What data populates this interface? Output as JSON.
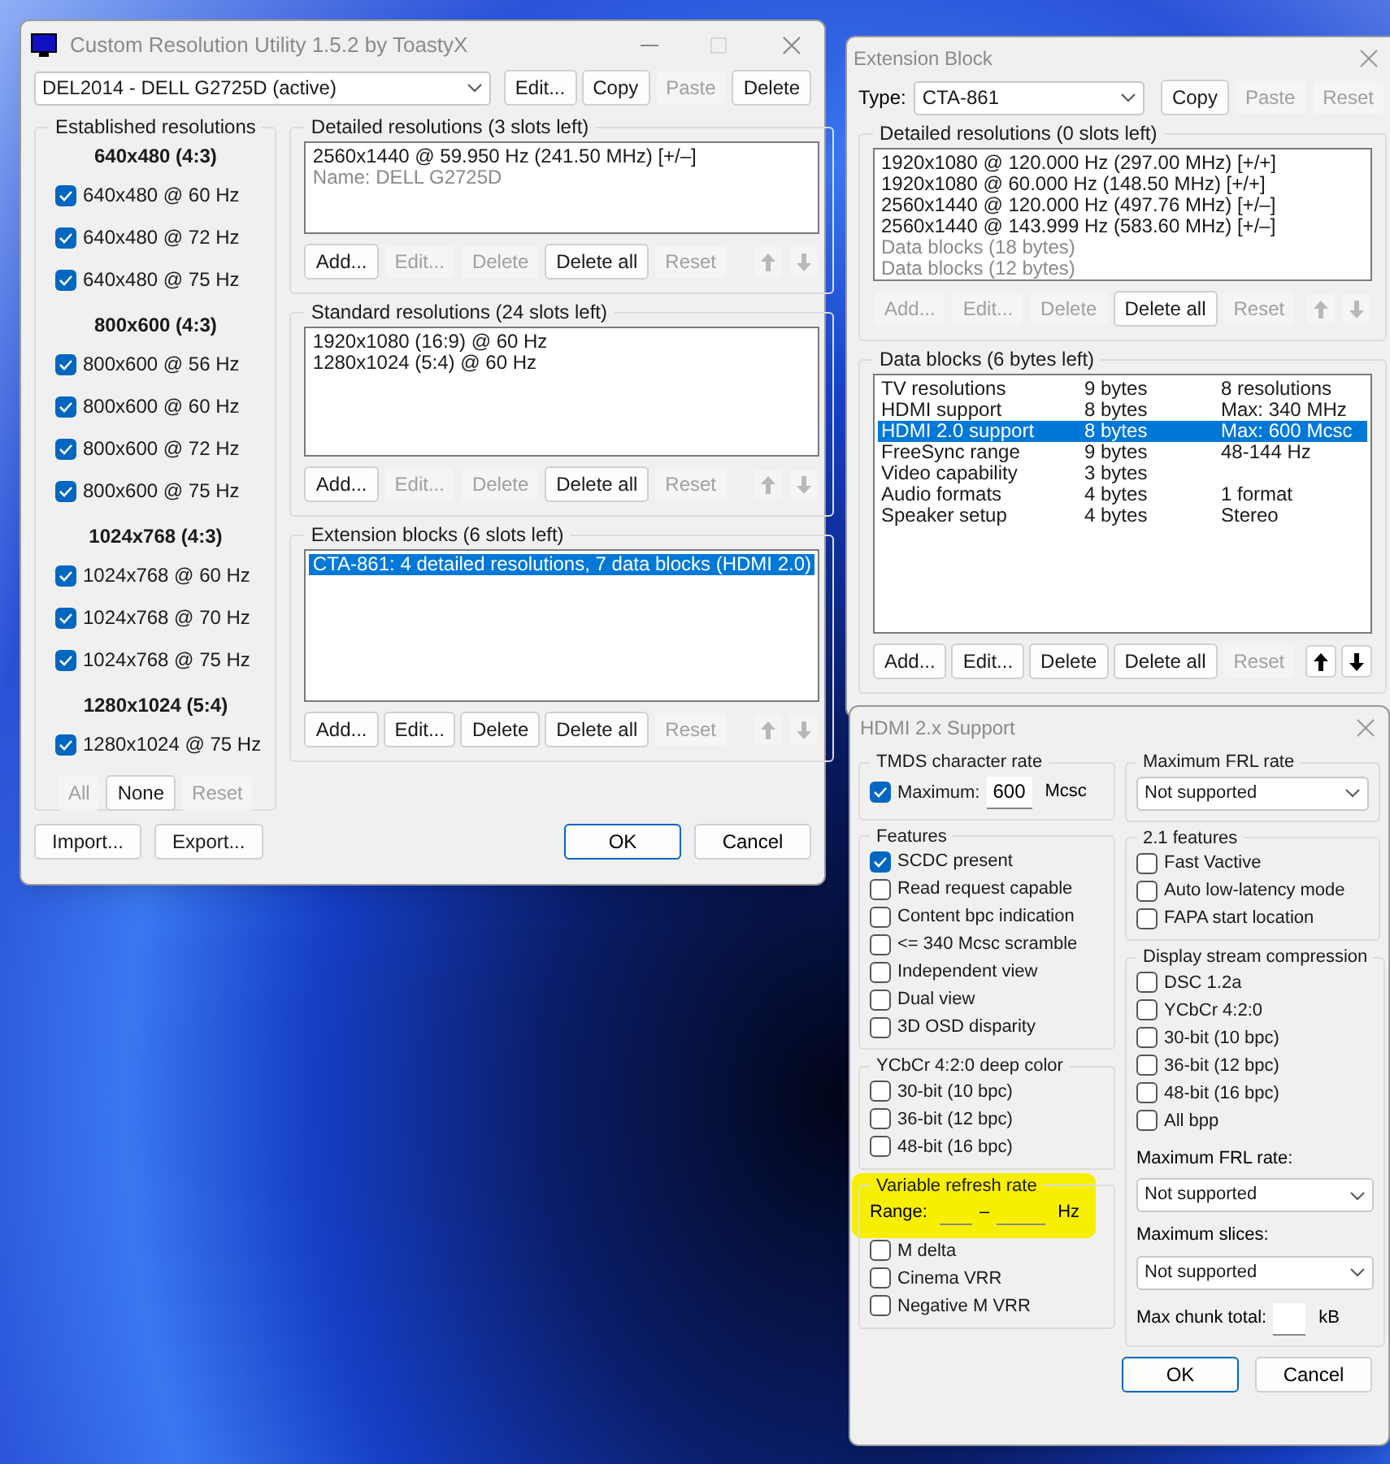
{
  "main_window": {
    "title": "Custom Resolution Utility 1.5.2 by ToastyX",
    "maximize_disabled": true,
    "monitor": "DEL2014 - DELL G2725D (active)",
    "top_buttons": [
      {
        "label": "Edit...",
        "disabled": false
      },
      {
        "label": "Copy",
        "disabled": false
      },
      {
        "label": "Paste",
        "disabled": true
      },
      {
        "label": "Delete",
        "disabled": false
      }
    ],
    "established": {
      "title": "Established resolutions",
      "groups": [
        {
          "heading": "640x480 (4:3)",
          "items": [
            {
              "label": "640x480 @ 60 Hz",
              "checked": true
            },
            {
              "label": "640x480 @ 72 Hz",
              "checked": true
            },
            {
              "label": "640x480 @ 75 Hz",
              "checked": true
            }
          ]
        },
        {
          "heading": "800x600 (4:3)",
          "items": [
            {
              "label": "800x600 @ 56 Hz",
              "checked": true
            },
            {
              "label": "800x600 @ 60 Hz",
              "checked": true
            },
            {
              "label": "800x600 @ 72 Hz",
              "checked": true
            },
            {
              "label": "800x600 @ 75 Hz",
              "checked": true
            }
          ]
        },
        {
          "heading": "1024x768 (4:3)",
          "items": [
            {
              "label": "1024x768 @ 60 Hz",
              "checked": true
            },
            {
              "label": "1024x768 @ 70 Hz",
              "checked": true
            },
            {
              "label": "1024x768 @ 75 Hz",
              "checked": true
            }
          ]
        },
        {
          "heading": "1280x1024 (5:4)",
          "items": [
            {
              "label": "1280x1024 @ 75 Hz",
              "checked": true
            }
          ]
        }
      ],
      "buttons": [
        {
          "label": "All",
          "disabled": true
        },
        {
          "label": "None",
          "disabled": false
        },
        {
          "label": "Reset",
          "disabled": true
        }
      ]
    },
    "detailed": {
      "title": "Detailed resolutions (3 slots left)",
      "lines": [
        {
          "text": "2560x1440 @ 59.950 Hz (241.50 MHz) [+/–]",
          "dim": false,
          "selected": false
        },
        {
          "text": "Name: DELL G2725D",
          "dim": true,
          "selected": false
        }
      ],
      "buttons": [
        {
          "label": "Add...",
          "disabled": false
        },
        {
          "label": "Edit...",
          "disabled": true
        },
        {
          "label": "Delete",
          "disabled": true
        },
        {
          "label": "Delete all",
          "disabled": false
        },
        {
          "label": "Reset",
          "disabled": true
        }
      ],
      "up_disabled": true,
      "down_disabled": true
    },
    "standard": {
      "title": "Standard resolutions (24 slots left)",
      "lines": [
        {
          "text": "1920x1080 (16:9) @ 60 Hz",
          "dim": false,
          "selected": false
        },
        {
          "text": "1280x1024 (5:4) @ 60 Hz",
          "dim": false,
          "selected": false
        }
      ],
      "buttons": [
        {
          "label": "Add...",
          "disabled": false
        },
        {
          "label": "Edit...",
          "disabled": true
        },
        {
          "label": "Delete",
          "disabled": true
        },
        {
          "label": "Delete all",
          "disabled": false
        },
        {
          "label": "Reset",
          "disabled": true
        }
      ],
      "up_disabled": true,
      "down_disabled": true
    },
    "extension": {
      "title": "Extension blocks (6 slots left)",
      "lines": [
        {
          "text": "CTA-861: 4 detailed resolutions, 7 data blocks (HDMI 2.0)",
          "dim": false,
          "selected": true
        }
      ],
      "buttons": [
        {
          "label": "Add...",
          "disabled": false
        },
        {
          "label": "Edit...",
          "disabled": false
        },
        {
          "label": "Delete",
          "disabled": false
        },
        {
          "label": "Delete all",
          "disabled": false
        },
        {
          "label": "Reset",
          "disabled": true
        }
      ],
      "up_disabled": true,
      "down_disabled": true
    },
    "footer_buttons": [
      {
        "label": "Import...",
        "disabled": false
      },
      {
        "label": "Export...",
        "disabled": false
      }
    ],
    "ok": "OK",
    "cancel": "Cancel"
  },
  "extension_window": {
    "title": "Extension Block",
    "type_label": "Type:",
    "type_value": "CTA-861",
    "top_buttons": [
      {
        "label": "Copy",
        "disabled": false
      },
      {
        "label": "Paste",
        "disabled": true
      },
      {
        "label": "Reset",
        "disabled": true
      }
    ],
    "detailed": {
      "title": "Detailed resolutions (0 slots left)",
      "lines": [
        {
          "text": "1920x1080 @ 120.000 Hz (297.00 MHz) [+/+]",
          "dim": false,
          "selected": false
        },
        {
          "text": "1920x1080 @ 60.000 Hz (148.50 MHz) [+/+]",
          "dim": false,
          "selected": false
        },
        {
          "text": "2560x1440 @ 120.000 Hz (497.76 MHz) [+/–]",
          "dim": false,
          "selected": false
        },
        {
          "text": "2560x1440 @ 143.999 Hz (583.60 MHz) [+/–]",
          "dim": false,
          "selected": false
        },
        {
          "text": "Data blocks (18 bytes)",
          "dim": true,
          "selected": false
        },
        {
          "text": "Data blocks (12 bytes)",
          "dim": true,
          "selected": false
        }
      ],
      "buttons": [
        {
          "label": "Add...",
          "disabled": true
        },
        {
          "label": "Edit...",
          "disabled": true
        },
        {
          "label": "Delete",
          "disabled": true
        },
        {
          "label": "Delete all",
          "disabled": false
        },
        {
          "label": "Reset",
          "disabled": true
        }
      ],
      "up_disabled": true,
      "down_disabled": true
    },
    "data_blocks": {
      "title": "Data blocks (6 bytes left)",
      "rows": [
        {
          "name": "TV resolutions",
          "size": "9 bytes",
          "info": "8 resolutions",
          "selected": false
        },
        {
          "name": "HDMI support",
          "size": "8 bytes",
          "info": "Max: 340 MHz",
          "selected": false
        },
        {
          "name": "HDMI 2.0 support",
          "size": "8 bytes",
          "info": "Max: 600 Mcsc",
          "selected": true
        },
        {
          "name": "FreeSync range",
          "size": "9 bytes",
          "info": "48-144 Hz",
          "selected": false
        },
        {
          "name": "Video capability",
          "size": "3 bytes",
          "selected": false
        },
        {
          "name": "Audio formats",
          "size": "4 bytes",
          "info": "1 format",
          "selected": false
        },
        {
          "name": "Speaker setup",
          "size": "4 bytes",
          "info": "Stereo",
          "selected": false
        }
      ],
      "buttons": [
        {
          "label": "Add...",
          "disabled": false
        },
        {
          "label": "Edit...",
          "disabled": false
        },
        {
          "label": "Delete",
          "disabled": false
        },
        {
          "label": "Delete all",
          "disabled": false
        },
        {
          "label": "Reset",
          "disabled": true
        }
      ],
      "up_disabled": false,
      "down_disabled": false
    }
  },
  "hdmi_window": {
    "title": "HDMI 2.x Support",
    "tmds": {
      "title": "TMDS character rate",
      "checkbox": {
        "label": "Maximum:",
        "checked": true
      },
      "value": "600",
      "unit": "Mcsc"
    },
    "max_frl": {
      "title": "Maximum FRL rate",
      "value": "Not supported"
    },
    "features": {
      "title": "Features",
      "items": [
        {
          "label": "SCDC present",
          "checked": true
        },
        {
          "label": "Read request capable",
          "checked": false
        },
        {
          "label": "Content bpc indication",
          "checked": false
        },
        {
          "label": "<= 340 Mcsc scramble",
          "checked": false
        },
        {
          "label": "Independent view",
          "checked": false
        },
        {
          "label": "Dual view",
          "checked": false
        },
        {
          "label": "3D OSD disparity",
          "checked": false
        }
      ]
    },
    "features21": {
      "title": "2.1 features",
      "items": [
        {
          "label": "Fast Vactive",
          "checked": false
        },
        {
          "label": "Auto low-latency mode",
          "checked": false
        },
        {
          "label": "FAPA start location",
          "checked": false
        }
      ]
    },
    "deep_color": {
      "title": "YCbCr 4:2:0 deep color",
      "items": [
        {
          "label": "30-bit (10 bpc)",
          "checked": false
        },
        {
          "label": "36-bit (12 bpc)",
          "checked": false
        },
        {
          "label": "48-bit (16 bpc)",
          "checked": false
        }
      ]
    },
    "dsc": {
      "title": "Display stream compression",
      "items": [
        {
          "label": "DSC 1.2a",
          "checked": false
        },
        {
          "label": "YCbCr 4:2:0",
          "checked": false
        },
        {
          "label": "30-bit (10 bpc)",
          "checked": false
        },
        {
          "label": "36-bit (12 bpc)",
          "checked": false
        },
        {
          "label": "48-bit (16 bpc)",
          "checked": false
        },
        {
          "label": "All bpp",
          "checked": false
        }
      ],
      "frl_label": "Maximum FRL rate:",
      "frl_value": "Not supported",
      "slices_label": "Maximum slices:",
      "slices_value": "Not supported",
      "chunk_label": "Max chunk total:",
      "chunk_unit": "kB"
    },
    "vrr": {
      "title": "Variable refresh rate",
      "highlighted": true,
      "range_label": "Range:",
      "dash": "–",
      "unit": "Hz",
      "items": [
        {
          "label": "M delta",
          "checked": false
        },
        {
          "label": "Cinema VRR",
          "checked": false
        },
        {
          "label": "Negative M VRR",
          "checked": false
        }
      ]
    },
    "ok": "OK",
    "cancel": "Cancel"
  }
}
